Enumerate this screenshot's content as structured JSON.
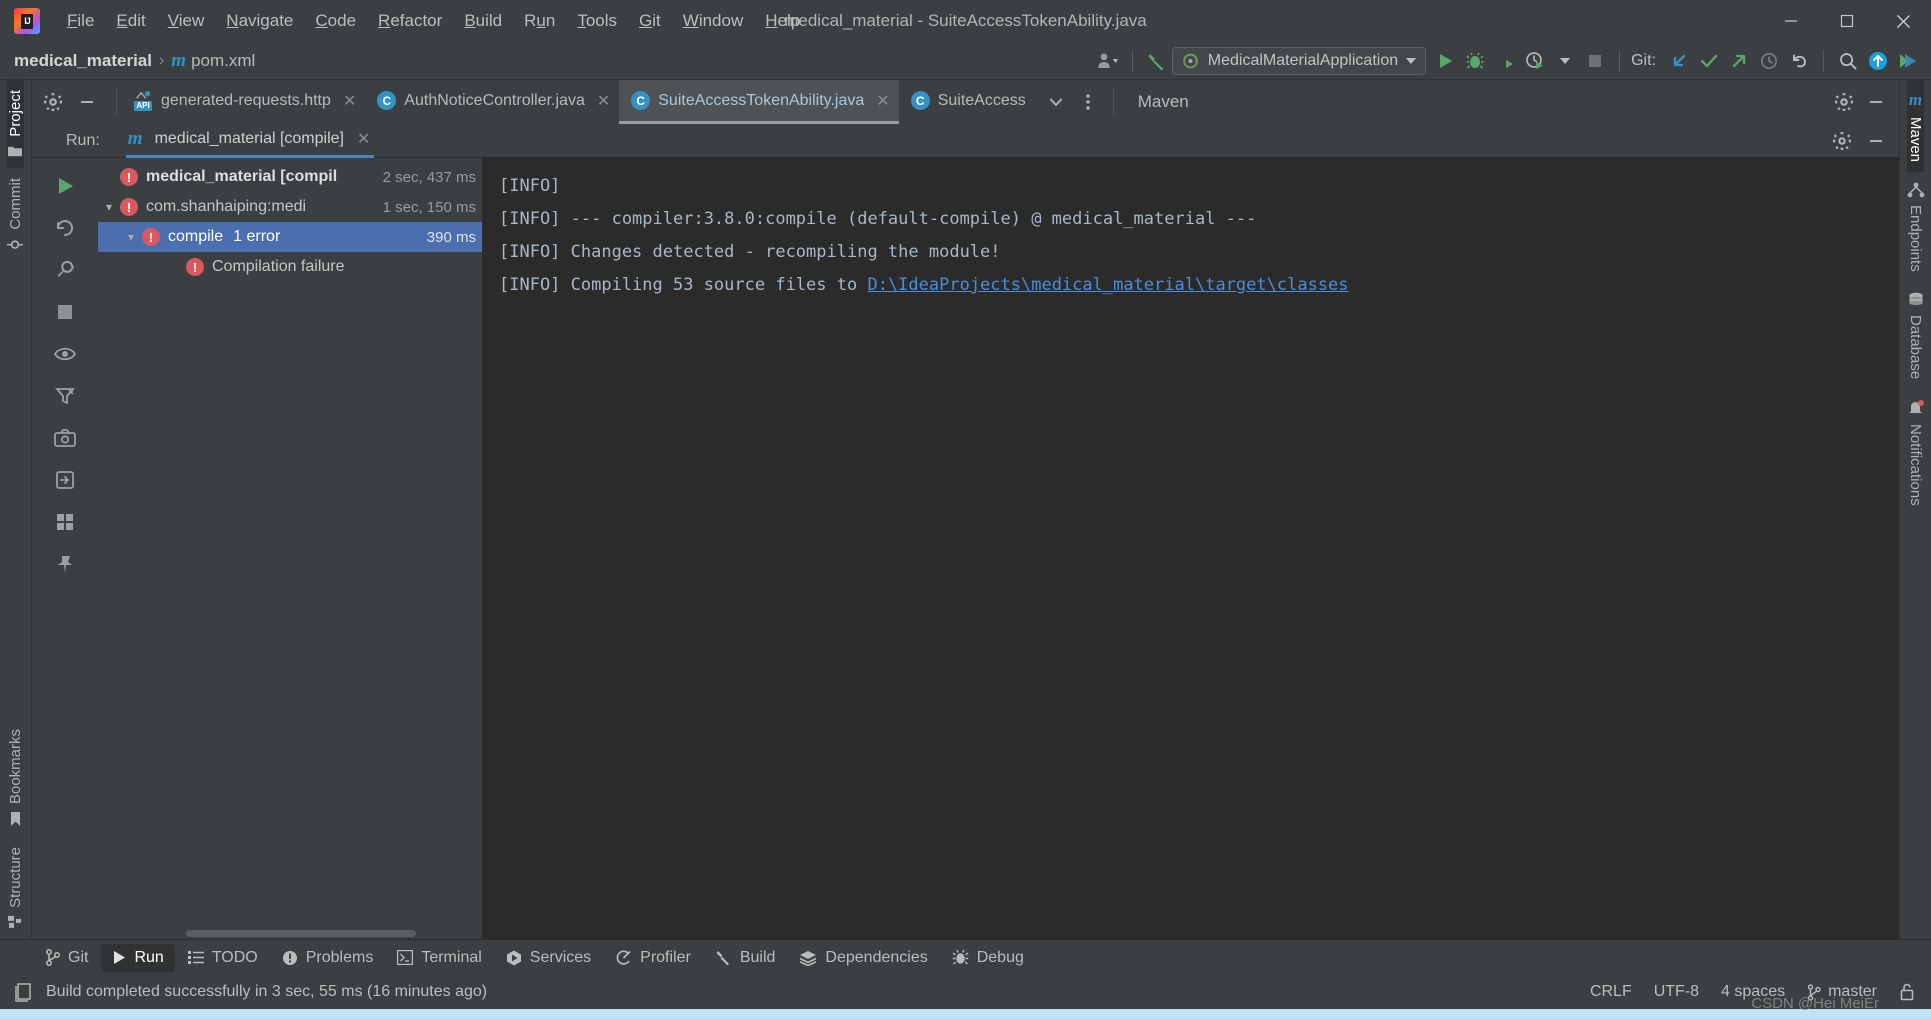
{
  "window": {
    "title": "medical_material - SuiteAccessTokenAbility.java",
    "controls": [
      {
        "name": "minimize-button",
        "glyph": "─"
      },
      {
        "name": "maximize-button",
        "glyph": "☐"
      },
      {
        "name": "close-button",
        "glyph": "✕"
      }
    ]
  },
  "menu": {
    "items": [
      {
        "label": "File",
        "mnemonic": "F"
      },
      {
        "label": "Edit",
        "mnemonic": "E"
      },
      {
        "label": "View",
        "mnemonic": "V"
      },
      {
        "label": "Navigate",
        "mnemonic": "N"
      },
      {
        "label": "Code",
        "mnemonic": "C"
      },
      {
        "label": "Refactor",
        "mnemonic": "R"
      },
      {
        "label": "Build",
        "mnemonic": "B"
      },
      {
        "label": "Run",
        "mnemonic": "u"
      },
      {
        "label": "Tools",
        "mnemonic": "T"
      },
      {
        "label": "Git",
        "mnemonic": "G"
      },
      {
        "label": "Window",
        "mnemonic": "W"
      },
      {
        "label": "Help",
        "mnemonic": "H"
      }
    ]
  },
  "navbar": {
    "breadcrumb": {
      "project": "medical_material",
      "separator": "›",
      "file_icon": "m",
      "file": "pom.xml"
    },
    "run_config": {
      "label": "MedicalMaterialApplication"
    },
    "git_label": "Git:",
    "icons": [
      "user-avatar-icon",
      "hammer-build-icon",
      "run-icon",
      "debug-icon",
      "run-coverage-icon",
      "profiler-icon",
      "stop-icon",
      "git-update-icon",
      "git-commit-icon",
      "git-push-icon",
      "git-history-icon",
      "git-rollback-icon",
      "search-everywhere-icon",
      "upload-icon",
      "plugin-icon"
    ]
  },
  "editor_tabs": {
    "tools": [
      "settings-gear-icon",
      "hide-icon"
    ],
    "tabs": [
      {
        "label": "generated-requests.http",
        "icon": "http-api-icon",
        "active": false,
        "closable": true
      },
      {
        "label": "AuthNoticeController.java",
        "icon": "java-class-icon",
        "active": false,
        "closable": true
      },
      {
        "label": "SuiteAccessTokenAbility.java",
        "icon": "java-class-icon",
        "active": true,
        "closable": true
      },
      {
        "label": "SuiteAccess",
        "icon": "java-class-icon",
        "active": false,
        "closable": false
      }
    ],
    "overflow": [
      "chevron-down-icon",
      "more-vertical-icon"
    ],
    "maven_panel_title": "Maven"
  },
  "run_window": {
    "header_label": "Run:",
    "tab": {
      "label": "medical_material [compile]",
      "icon": "maven-m-icon"
    },
    "gutter_icons": [
      "rerun-icon",
      "rerun-failed-icon",
      "settings-wrench-icon",
      "stop-icon",
      "eye-toggle-icon",
      "filter-icon",
      "screenshot-icon",
      "export-icon",
      "layout-icon",
      "pin-icon"
    ],
    "tree": [
      {
        "label": "medical_material [compil",
        "duration": "2 sec, 437 ms",
        "indent": 0,
        "bold": true,
        "expandable": false,
        "selected": false,
        "status": "error"
      },
      {
        "label": "com.shanhaiping:medi",
        "duration": "1 sec, 150 ms",
        "indent": 1,
        "bold": false,
        "expandable": true,
        "selected": false,
        "status": "error"
      },
      {
        "label": "compile",
        "extra": "1 error",
        "duration": "390 ms",
        "indent": 2,
        "bold": false,
        "expandable": true,
        "selected": true,
        "status": "error"
      },
      {
        "label": "Compilation failure",
        "duration": "",
        "indent": 3,
        "bold": false,
        "expandable": false,
        "selected": false,
        "status": "error"
      }
    ],
    "console": [
      {
        "text": "[INFO]",
        "link": ""
      },
      {
        "text": "[INFO] --- compiler:3.8.0:compile (default-compile) @ medical_material ---",
        "link": ""
      },
      {
        "text": "[INFO] Changes detected - recompiling the module!",
        "link": ""
      },
      {
        "text": "[INFO] Compiling 53 source files to ",
        "link": "D:\\IdeaProjects\\medical_material\\target\\classes"
      }
    ]
  },
  "left_stripe": {
    "top": [
      {
        "label": "Project",
        "icon": "project-folder-icon",
        "active": true
      },
      {
        "label": "Commit",
        "icon": "commit-icon",
        "active": false
      }
    ],
    "bottom": [
      {
        "label": "Bookmarks",
        "icon": "bookmark-icon",
        "active": false
      },
      {
        "label": "Structure",
        "icon": "structure-icon",
        "active": false
      }
    ]
  },
  "right_stripe": {
    "items": [
      {
        "label": "Maven",
        "icon": "maven-m-icon",
        "active": true
      },
      {
        "label": "Endpoints",
        "icon": "endpoints-icon",
        "active": false
      },
      {
        "label": "Database",
        "icon": "database-icon",
        "active": false
      },
      {
        "label": "Notifications",
        "icon": "notifications-bell-icon",
        "active": false,
        "badge": true
      }
    ]
  },
  "bottom_tabs": [
    {
      "label": "Git",
      "icon": "git-branch-icon",
      "active": false
    },
    {
      "label": "Run",
      "icon": "run-play-icon",
      "active": true
    },
    {
      "label": "TODO",
      "icon": "todo-list-icon",
      "active": false
    },
    {
      "label": "Problems",
      "icon": "problems-icon",
      "active": false
    },
    {
      "label": "Terminal",
      "icon": "terminal-icon",
      "active": false
    },
    {
      "label": "Services",
      "icon": "services-icon",
      "active": false
    },
    {
      "label": "Profiler",
      "icon": "profiler-icon",
      "active": false
    },
    {
      "label": "Build",
      "icon": "hammer-build-icon",
      "active": false
    },
    {
      "label": "Dependencies",
      "icon": "dependencies-icon",
      "active": false
    },
    {
      "label": "Debug",
      "icon": "debug-bug-icon",
      "active": false
    }
  ],
  "status_bar": {
    "message": "Build completed successfully in 3 sec, 55 ms (16 minutes ago)",
    "line_separator": "CRLF",
    "encoding": "UTF-8",
    "indent": "4 spaces",
    "branch": "master",
    "watermark": "CSDN @Hei MeiEr"
  },
  "colors": {
    "accent_blue": "#4b6eaf",
    "error_red": "#db5860",
    "link_blue": "#4a8ddc",
    "green_run": "#59a869",
    "panel_bg": "#3c3f41",
    "console_bg": "#2b2b2b"
  }
}
